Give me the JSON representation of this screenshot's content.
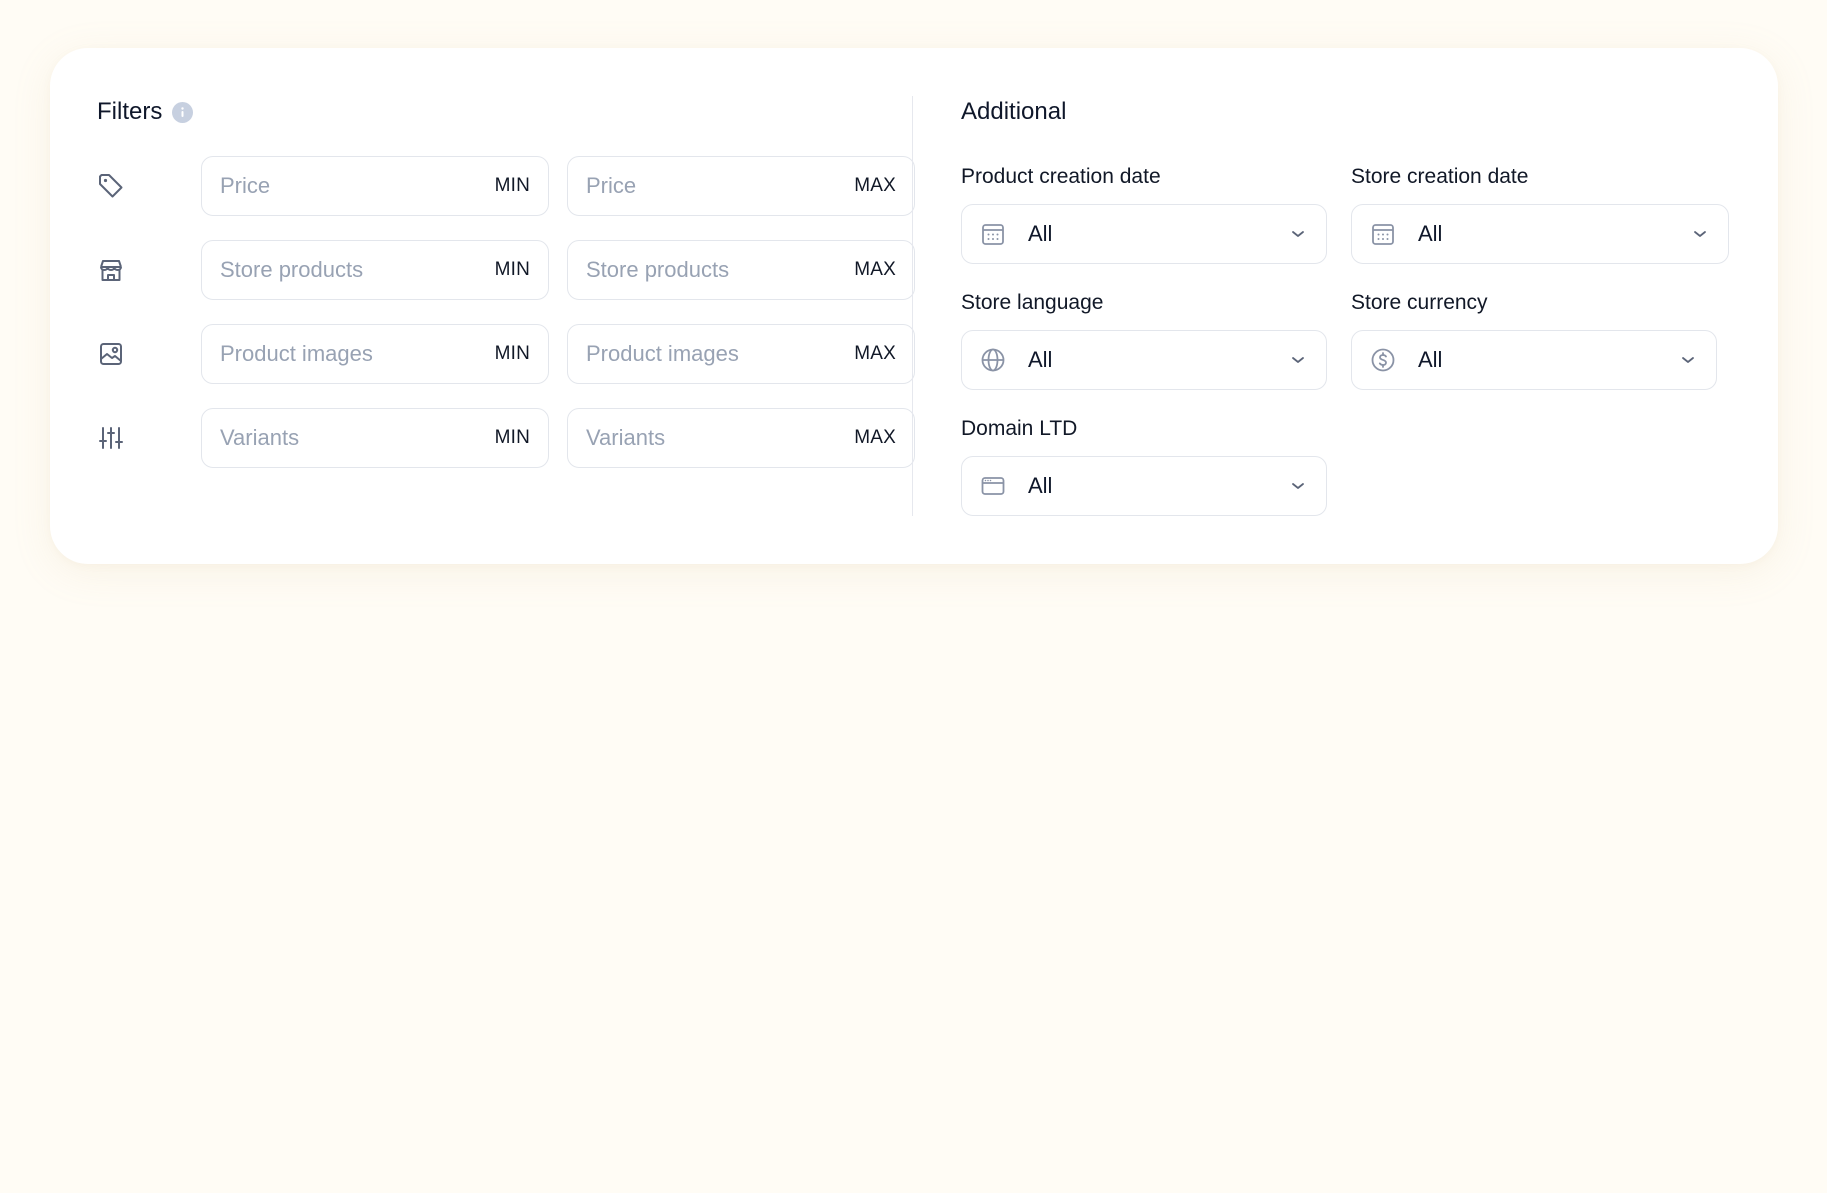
{
  "filters": {
    "title": "Filters",
    "rows": [
      {
        "icon": "tag-icon",
        "min_placeholder": "Price",
        "max_placeholder": "Price",
        "min_suffix": "MIN",
        "max_suffix": "MAX"
      },
      {
        "icon": "store-icon",
        "min_placeholder": "Store products",
        "max_placeholder": "Store products",
        "min_suffix": "MIN",
        "max_suffix": "MAX"
      },
      {
        "icon": "image-icon",
        "min_placeholder": "Product images",
        "max_placeholder": "Product images",
        "min_suffix": "MIN",
        "max_suffix": "MAX"
      },
      {
        "icon": "sliders-icon",
        "min_placeholder": "Variants",
        "max_placeholder": "Variants",
        "min_suffix": "MIN",
        "max_suffix": "MAX"
      }
    ]
  },
  "additional": {
    "title": "Additional",
    "fields": [
      {
        "label": "Product creation date",
        "value": "All",
        "icon": "calendar-icon"
      },
      {
        "label": "Store creation date",
        "value": "All",
        "icon": "calendar-icon"
      },
      {
        "label": "Store language",
        "value": "All",
        "icon": "globe-icon"
      },
      {
        "label": "Store currency",
        "value": "All",
        "icon": "dollar-circle-icon"
      },
      {
        "label": "Domain LTD",
        "value": "All",
        "icon": "browser-window-icon"
      }
    ]
  },
  "colors": {
    "background": "#fffcf5",
    "card": "#ffffff",
    "border": "#e3e6ec",
    "placeholder": "#98a2b3",
    "icon": "#5b6478"
  }
}
